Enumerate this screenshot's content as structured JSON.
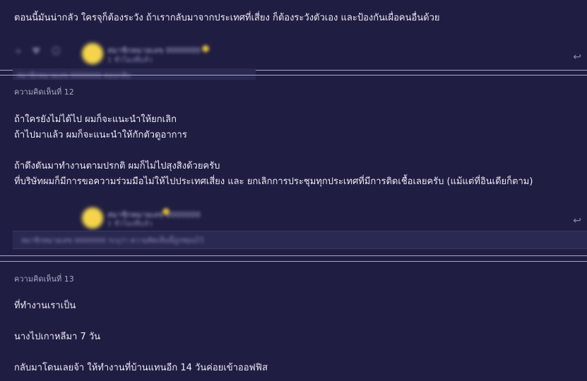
{
  "comment_11": {
    "text": "ตอนนี้มันน่ากลัว ใครจุก็ต้องระวัง ถ้าเรากลับมาจากประเทศที่เสี่ยง ก็ต้องระวังตัวเอง และป้องกันเผื่อคนอื่นด้วย",
    "author_name": "สมาชิกหมายเลข 0000000",
    "author_sub": "1 ชั่วโมงที่แล้ว",
    "extra_line": "สมาชิกหมายเลข 0000000 ตอบกลับ"
  },
  "comment_12": {
    "label": "ความคิดเห็นที่ 12",
    "lines": [
      "ถ้าใครยังไม่ได้ไป ผมก็จะแนะนำให้ยกเลิก",
      "ถ้าไปมาแล้ว ผมก็จะแนะนำให้กักตัวดูอาการ",
      "",
      "ถ้าดึงดันมาทำงานตามปรกติ ผมก็ไม่ไปสุงสิงด้วยครับ",
      "ที่บริษัทผมก็มีการขอความร่วมมือไม่ให้ไปประเทศเสี่ยง และ ยกเลิกการประชุมทุกประเทศที่มีการติดเชื้อเลยครับ (แม้แต่ที่อินเดียก็ตาม)"
    ],
    "author_name": "สมาชิกหมายเลข 0000000",
    "author_sub": "1 ชั่วโมงที่แล้ว",
    "extra_line": "สมาชิกหมายเลข 0000000 ระบุว่า ความคิดเห็นนี้ถูกซ่อนไว้"
  },
  "comment_13": {
    "label": "ความคิดเห็นที่ 13",
    "lines": [
      "ที่ทำงานเราเป็น",
      "นางไปเกาหลีมา 7 วัน",
      "กลับมาโดนเลยจ้า ให้ทำงานที่บ้านแทนอีก 14 วันค่อยเข้าออฟฟิส"
    ]
  },
  "icons": {
    "plus": "+",
    "like": "♥",
    "emoji": "☺",
    "reply": "↩"
  }
}
